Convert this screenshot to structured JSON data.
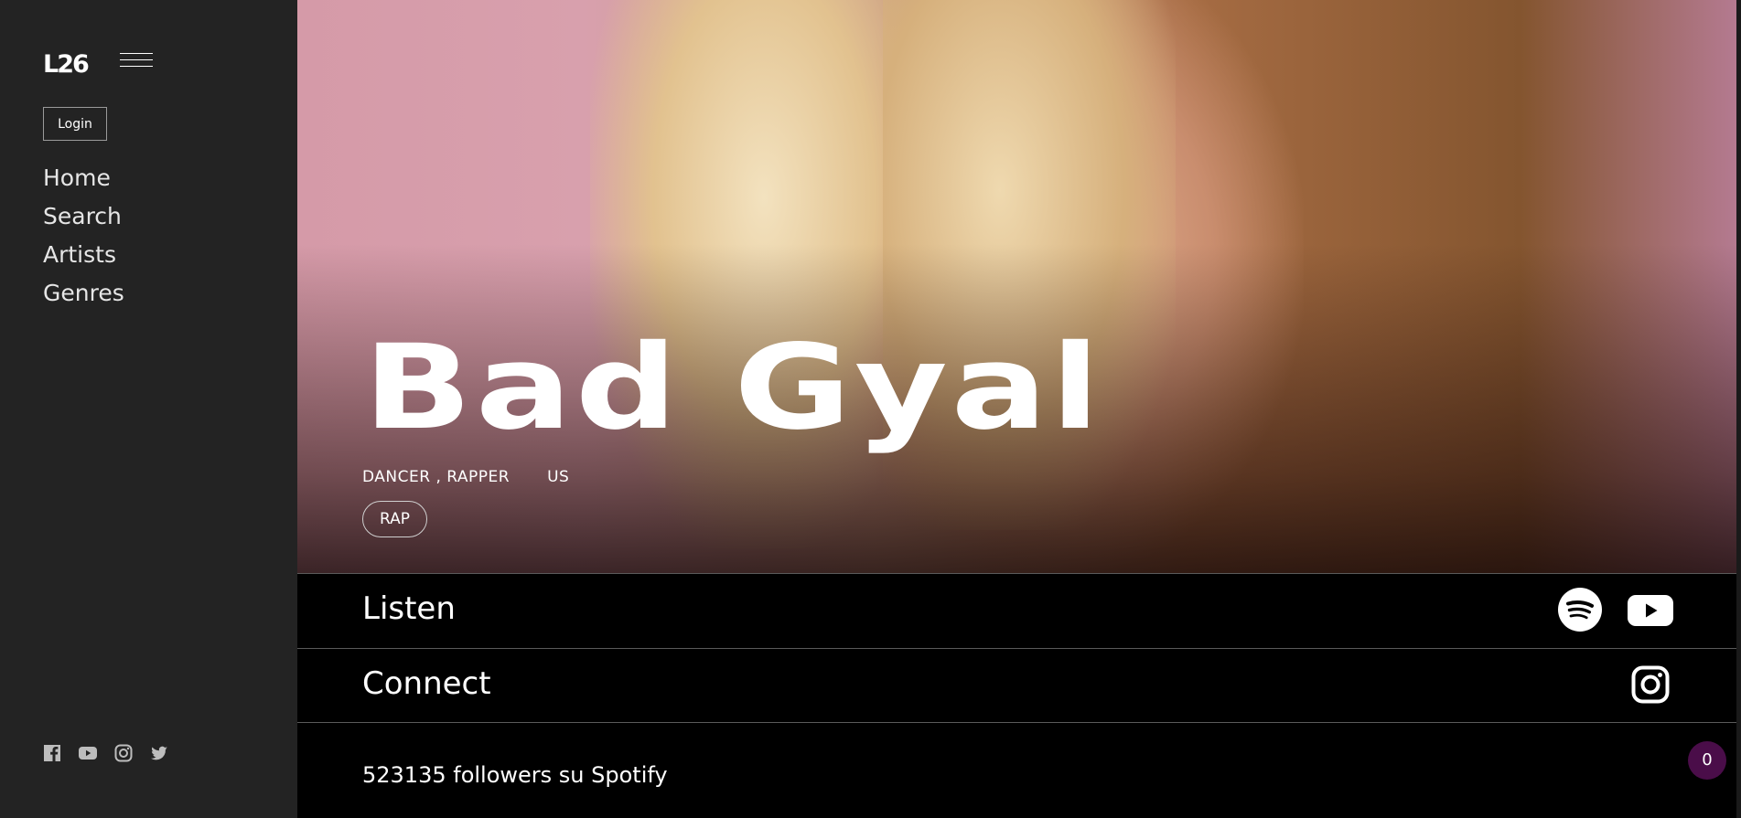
{
  "sidebar": {
    "logo": "L26",
    "login_label": "Login",
    "nav": [
      "Home",
      "Search",
      "Artists",
      "Genres"
    ],
    "social_icons": [
      "facebook-icon",
      "youtube-icon",
      "instagram-icon",
      "twitter-icon"
    ]
  },
  "artist": {
    "name": "Bad Gyal",
    "roles": "DANCER , RAPPER",
    "country": "US",
    "genre_tag": "RAP"
  },
  "sections": {
    "listen_label": "Listen",
    "connect_label": "Connect",
    "listen_icons": [
      "spotify-icon",
      "youtube-icon"
    ],
    "connect_icons": [
      "instagram-icon"
    ]
  },
  "followers_text": "523135 followers su Spotify",
  "badge_count": "0"
}
